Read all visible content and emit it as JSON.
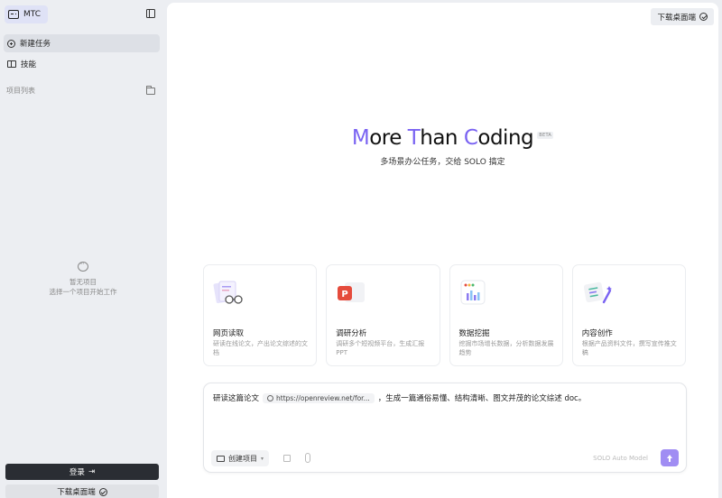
{
  "sidebar": {
    "brand": "MTC",
    "nav": [
      {
        "label": "新建任务",
        "icon": "plus-circle-icon"
      },
      {
        "label": "技能",
        "icon": "book-icon"
      }
    ],
    "projects_header": "项目列表",
    "empty_title": "暂无项目",
    "empty_hint": "选择一个项目开始工作",
    "login_label": "登录",
    "download_label": "下载桌面端"
  },
  "header": {
    "download_label": "下载桌面端"
  },
  "hero": {
    "title_parts": [
      "M",
      "ore ",
      "T",
      "han ",
      "C",
      "oding"
    ],
    "badge": "BETA",
    "subtitle": "多场景办公任务，交给 SOLO 搞定",
    "accent_color": "#7a63f2"
  },
  "cards": [
    {
      "title": "网页读取",
      "desc": "研读在线论文，产出论文综述的文档",
      "icon": "web-reading-icon"
    },
    {
      "title": "调研分析",
      "desc": "调研多个短视频平台，生成汇报 PPT",
      "icon": "ppt-icon"
    },
    {
      "title": "数据挖掘",
      "desc": "挖掘市场增长数据，分析数据发展趋势",
      "icon": "chart-icon"
    },
    {
      "title": "内容创作",
      "desc": "根据产品资料文件，撰写宣传推文稿",
      "icon": "writing-icon"
    }
  ],
  "composer": {
    "text_before": "研读这篇论文",
    "link": "https://openreview.net/for...",
    "text_after": "，生成一篇通俗易懂、结构清晰、图文并茂的论文综述 doc。",
    "project_button": "创建项目",
    "model": "SOLO Auto Model"
  }
}
